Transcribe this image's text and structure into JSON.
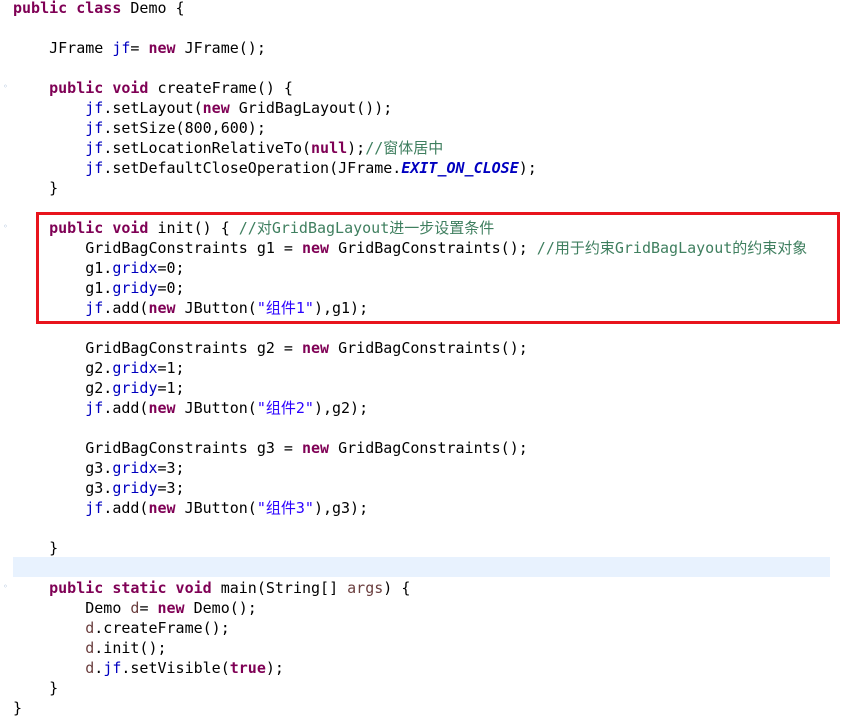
{
  "editor": {
    "marker_glyph": "◦",
    "lines": [
      {
        "tokens": [
          {
            "t": "public class",
            "c": "kw"
          },
          {
            "t": " Demo {",
            "c": ""
          }
        ]
      },
      {
        "tokens": []
      },
      {
        "tokens": [
          {
            "t": "    JFrame ",
            "c": ""
          },
          {
            "t": "jf",
            "c": "fld"
          },
          {
            "t": "= ",
            "c": ""
          },
          {
            "t": "new",
            "c": "kw"
          },
          {
            "t": " JFrame();",
            "c": ""
          }
        ]
      },
      {
        "tokens": []
      },
      {
        "tokens": [
          {
            "t": "    ",
            "c": ""
          },
          {
            "t": "public void",
            "c": "kw"
          },
          {
            "t": " createFrame() {",
            "c": ""
          }
        ]
      },
      {
        "tokens": [
          {
            "t": "        ",
            "c": ""
          },
          {
            "t": "jf",
            "c": "fld"
          },
          {
            "t": ".setLayout(",
            "c": ""
          },
          {
            "t": "new",
            "c": "kw"
          },
          {
            "t": " GridBagLayout());",
            "c": ""
          }
        ]
      },
      {
        "tokens": [
          {
            "t": "        ",
            "c": ""
          },
          {
            "t": "jf",
            "c": "fld"
          },
          {
            "t": ".setSize(800,600);",
            "c": ""
          }
        ]
      },
      {
        "tokens": [
          {
            "t": "        ",
            "c": ""
          },
          {
            "t": "jf",
            "c": "fld"
          },
          {
            "t": ".setLocationRelativeTo(",
            "c": ""
          },
          {
            "t": "null",
            "c": "kw"
          },
          {
            "t": ");",
            "c": ""
          },
          {
            "t": "//窗体居中",
            "c": "cmt"
          }
        ]
      },
      {
        "tokens": [
          {
            "t": "        ",
            "c": ""
          },
          {
            "t": "jf",
            "c": "fld"
          },
          {
            "t": ".setDefaultCloseOperation(JFrame.",
            "c": ""
          },
          {
            "t": "EXIT_ON_CLOSE",
            "c": "sfld"
          },
          {
            "t": ");",
            "c": ""
          }
        ]
      },
      {
        "tokens": [
          {
            "t": "    }",
            "c": ""
          }
        ]
      },
      {
        "tokens": []
      },
      {
        "tokens": [
          {
            "t": "    ",
            "c": ""
          },
          {
            "t": "public void",
            "c": "kw"
          },
          {
            "t": " init() { ",
            "c": ""
          },
          {
            "t": "//对GridBagLayout进一步设置条件",
            "c": "cmt"
          }
        ]
      },
      {
        "tokens": [
          {
            "t": "        GridBagConstraints g1 = ",
            "c": ""
          },
          {
            "t": "new",
            "c": "kw"
          },
          {
            "t": " GridBagConstraints(); ",
            "c": ""
          },
          {
            "t": "//用于约束GridBagLayout的约束对象",
            "c": "cmt"
          }
        ]
      },
      {
        "tokens": [
          {
            "t": "        g1.",
            "c": ""
          },
          {
            "t": "gridx",
            "c": "fld"
          },
          {
            "t": "=0;",
            "c": ""
          }
        ]
      },
      {
        "tokens": [
          {
            "t": "        g1.",
            "c": ""
          },
          {
            "t": "gridy",
            "c": "fld"
          },
          {
            "t": "=0;",
            "c": ""
          }
        ]
      },
      {
        "tokens": [
          {
            "t": "        ",
            "c": ""
          },
          {
            "t": "jf",
            "c": "fld"
          },
          {
            "t": ".add(",
            "c": ""
          },
          {
            "t": "new",
            "c": "kw"
          },
          {
            "t": " JButton(",
            "c": ""
          },
          {
            "t": "\"组件1\"",
            "c": "str"
          },
          {
            "t": "),g1);",
            "c": ""
          }
        ]
      },
      {
        "tokens": []
      },
      {
        "tokens": [
          {
            "t": "        GridBagConstraints g2 = ",
            "c": ""
          },
          {
            "t": "new",
            "c": "kw"
          },
          {
            "t": " GridBagConstraints();",
            "c": ""
          }
        ]
      },
      {
        "tokens": [
          {
            "t": "        g2.",
            "c": ""
          },
          {
            "t": "gridx",
            "c": "fld"
          },
          {
            "t": "=1;",
            "c": ""
          }
        ]
      },
      {
        "tokens": [
          {
            "t": "        g2.",
            "c": ""
          },
          {
            "t": "gridy",
            "c": "fld"
          },
          {
            "t": "=1;",
            "c": ""
          }
        ]
      },
      {
        "tokens": [
          {
            "t": "        ",
            "c": ""
          },
          {
            "t": "jf",
            "c": "fld"
          },
          {
            "t": ".add(",
            "c": ""
          },
          {
            "t": "new",
            "c": "kw"
          },
          {
            "t": " JButton(",
            "c": ""
          },
          {
            "t": "\"组件2\"",
            "c": "str"
          },
          {
            "t": "),g2);",
            "c": ""
          }
        ]
      },
      {
        "tokens": []
      },
      {
        "tokens": [
          {
            "t": "        GridBagConstraints g3 = ",
            "c": ""
          },
          {
            "t": "new",
            "c": "kw"
          },
          {
            "t": " GridBagConstraints();",
            "c": ""
          }
        ]
      },
      {
        "tokens": [
          {
            "t": "        g3.",
            "c": ""
          },
          {
            "t": "gridx",
            "c": "fld"
          },
          {
            "t": "=3;",
            "c": ""
          }
        ]
      },
      {
        "tokens": [
          {
            "t": "        g3.",
            "c": ""
          },
          {
            "t": "gridy",
            "c": "fld"
          },
          {
            "t": "=3;",
            "c": ""
          }
        ]
      },
      {
        "tokens": [
          {
            "t": "        ",
            "c": ""
          },
          {
            "t": "jf",
            "c": "fld"
          },
          {
            "t": ".add(",
            "c": ""
          },
          {
            "t": "new",
            "c": "kw"
          },
          {
            "t": " JButton(",
            "c": ""
          },
          {
            "t": "\"组件3\"",
            "c": "str"
          },
          {
            "t": "),g3);",
            "c": ""
          }
        ]
      },
      {
        "tokens": []
      },
      {
        "tokens": [
          {
            "t": "    }",
            "c": ""
          }
        ]
      },
      {
        "tokens": []
      },
      {
        "tokens": [
          {
            "t": "    ",
            "c": ""
          },
          {
            "t": "public static void",
            "c": "kw"
          },
          {
            "t": " main(String[] ",
            "c": ""
          },
          {
            "t": "args",
            "c": "arg"
          },
          {
            "t": ") {",
            "c": ""
          }
        ]
      },
      {
        "tokens": [
          {
            "t": "        Demo ",
            "c": ""
          },
          {
            "t": "d",
            "c": "arg"
          },
          {
            "t": "= ",
            "c": ""
          },
          {
            "t": "new",
            "c": "kw"
          },
          {
            "t": " Demo();",
            "c": ""
          }
        ]
      },
      {
        "tokens": [
          {
            "t": "        ",
            "c": ""
          },
          {
            "t": "d",
            "c": "arg"
          },
          {
            "t": ".createFrame();",
            "c": ""
          }
        ]
      },
      {
        "tokens": [
          {
            "t": "        ",
            "c": ""
          },
          {
            "t": "d",
            "c": "arg"
          },
          {
            "t": ".init();",
            "c": ""
          }
        ]
      },
      {
        "tokens": [
          {
            "t": "        ",
            "c": ""
          },
          {
            "t": "d",
            "c": "arg"
          },
          {
            "t": ".",
            "c": ""
          },
          {
            "t": "jf",
            "c": "fld"
          },
          {
            "t": ".setVisible(",
            "c": ""
          },
          {
            "t": "true",
            "c": "kw"
          },
          {
            "t": ");",
            "c": ""
          }
        ]
      },
      {
        "tokens": [
          {
            "t": "    }",
            "c": ""
          }
        ]
      },
      {
        "tokens": [
          {
            "t": "}",
            "c": ""
          }
        ]
      }
    ]
  }
}
